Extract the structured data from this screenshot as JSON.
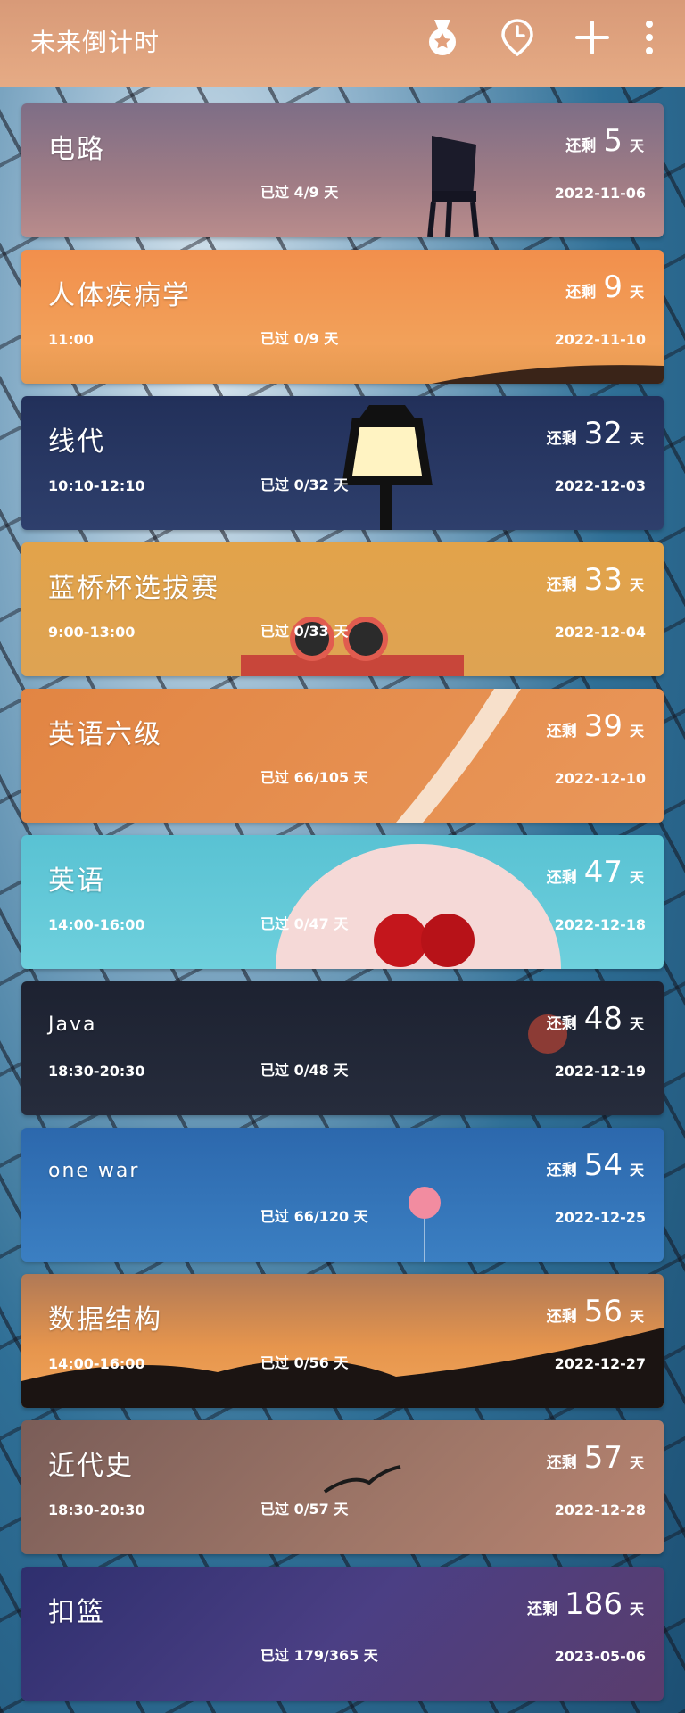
{
  "app": {
    "title": "未来倒计时"
  },
  "toolbar": {
    "icons": [
      "medal-icon",
      "clock-pin-icon",
      "plus-icon",
      "more-vert-icon"
    ]
  },
  "labels": {
    "remain": "还剩",
    "unit": "天"
  },
  "cards": [
    {
      "name": "电路",
      "time": "",
      "passed": "已过 4/9 天",
      "days": "5",
      "date": "2022-11-06",
      "bg": "#8c6f80"
    },
    {
      "name": "人体疾病学",
      "time": "11:00",
      "passed": "已过 0/9 天",
      "days": "9",
      "date": "2022-11-10",
      "bg": "#ee9a55"
    },
    {
      "name": "线代",
      "time": "10:10-12:10",
      "passed": "已过 0/32 天",
      "days": "32",
      "date": "2022-12-03",
      "bg": "#25345c"
    },
    {
      "name": "蓝桥杯选拔赛",
      "time": "9:00-13:00",
      "passed": "已过 0/33 天",
      "days": "33",
      "date": "2022-12-04",
      "bg": "#e1a64c"
    },
    {
      "name": "英语六级",
      "time": "",
      "passed": "已过 66/105 天",
      "days": "39",
      "date": "2022-12-10",
      "bg": "#e48d4c"
    },
    {
      "name": "英语",
      "time": "14:00-16:00",
      "passed": "已过 0/47 天",
      "days": "47",
      "date": "2022-12-18",
      "bg": "#5ec7d6"
    },
    {
      "name": "Java",
      "time": "18:30-20:30",
      "passed": "已过 0/48 天",
      "days": "48",
      "date": "2022-12-19",
      "bg": "#1f2535"
    },
    {
      "name": "one war",
      "time": "",
      "passed": "已过 66/120 天",
      "days": "54",
      "date": "2022-12-25",
      "bg": "#2d6fb2"
    },
    {
      "name": "数据结构",
      "time": "14:00-16:00",
      "passed": "已过 0/56 天",
      "days": "56",
      "date": "2022-12-27",
      "bg": "#d48a4a"
    },
    {
      "name": "近代史",
      "time": "18:30-20:30",
      "passed": "已过 0/57 天",
      "days": "57",
      "date": "2022-12-28",
      "bg": "#8d6a5c"
    },
    {
      "name": "扣篮",
      "time": "",
      "passed": "已过 179/365 天",
      "days": "186",
      "date": "2023-05-06",
      "bg": "#3c3a78"
    }
  ]
}
